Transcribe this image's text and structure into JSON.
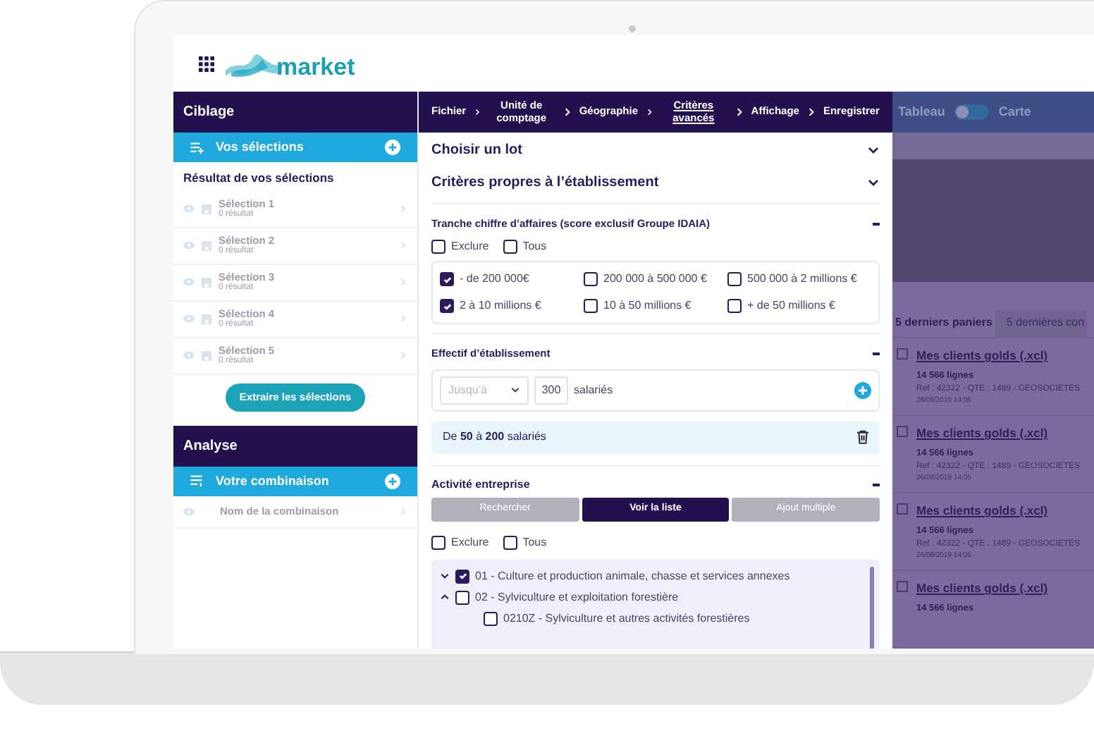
{
  "header": {
    "logo": "market"
  },
  "sidebar": {
    "ciblage": {
      "title": "Ciblage",
      "selections_header": "Vos sélections",
      "results_title": "Résultat de vos sélections",
      "selections": [
        {
          "name": "Sélection 1",
          "count": "0 résultat"
        },
        {
          "name": "Sélection 2",
          "count": "0 résultat"
        },
        {
          "name": "Sélection 3",
          "count": "0 résultat"
        },
        {
          "name": "Sélection 4",
          "count": "0 résultat"
        },
        {
          "name": "Sélection 5",
          "count": "0 résultat"
        }
      ],
      "extract_button": "Extraire les sélections"
    },
    "analyse": {
      "title": "Analyse",
      "combination_header": "Votre combinaison",
      "combination_placeholder": "Nom de la combinaison"
    }
  },
  "breadcrumb": [
    {
      "label": "Fichier",
      "selected": false
    },
    {
      "label": "Unité de comptage",
      "selected": false
    },
    {
      "label": "Géographie",
      "selected": false
    },
    {
      "label": "Critères avancés",
      "selected": true
    },
    {
      "label": "Affichage",
      "selected": false
    },
    {
      "label": "Enregistrer",
      "selected": false
    }
  ],
  "sections": [
    {
      "title": "Choisir un lot"
    },
    {
      "title": "Critères propres à l’établissement"
    }
  ],
  "revenue": {
    "title": "Tranche chiffre d’affaires (score exclusif Groupe IDAIA)",
    "options": [
      {
        "label": "Exclure",
        "checked": false
      },
      {
        "label": "Tous",
        "checked": false
      }
    ],
    "ranges": [
      {
        "label": "- de 200 000€",
        "checked": true
      },
      {
        "label": "200 000 à 500 000 €",
        "checked": false
      },
      {
        "label": "500 000 à 2 millions €",
        "checked": false
      },
      {
        "label": "2 à 10 millions €",
        "checked": true
      },
      {
        "label": "10 à 50 millions €",
        "checked": false
      },
      {
        "label": "+ de 50 millions €",
        "checked": false
      }
    ]
  },
  "workforce": {
    "title": "Effectif d’établissement",
    "operator": "Jusqu’à",
    "value": "300",
    "unit": "salariés",
    "range": "De **50** à **200** salariés"
  },
  "activity": {
    "title": "Activité entreprise",
    "buttons": [
      {
        "label": "Rechercher",
        "disabled": true
      },
      {
        "label": "Voir la liste",
        "disabled": false
      },
      {
        "label": "Ajout multiple",
        "disabled": true
      }
    ],
    "options": [
      {
        "label": "Exclure",
        "checked": false
      },
      {
        "label": "Tous",
        "checked": false
      }
    ],
    "tree": [
      {
        "label": "01 - Culture et production animale, chasse et services annexes",
        "checked": true,
        "expanded": false
      },
      {
        "label": "02 - Sylviculture et exploitation forestière",
        "checked": false,
        "expanded": true,
        "children": [
          {
            "label": "0210Z - Sylviculture et autres activités forestières",
            "checked": false
          }
        ]
      }
    ]
  },
  "right_panel": {
    "view_toggle": {
      "left": "Tableau",
      "right": "Carte",
      "on": false
    },
    "tabs": [
      {
        "label": "5 derniers paniers",
        "selected": true
      },
      {
        "label": "5 dernières con",
        "selected": false
      }
    ],
    "baskets": [
      {
        "name": "Mes clients golds (.xcl)",
        "checked": false,
        "lines": "14 566 lignes",
        "ref": "Ref : 42322 - QTE : 1489 - GEOSOCIETES",
        "date": "26/08/2019 14:05"
      },
      {
        "name": "Mes clients golds (.xcl)",
        "checked": false,
        "lines": "14 566 lignes",
        "ref": "Ref : 42322 - QTE : 1489 - GEOSOCIETES",
        "date": "26/08/2019 14:05"
      },
      {
        "name": "Mes clients golds (.xcl)",
        "checked": false,
        "lines": "14 566 lignes",
        "ref": "Ref : 42322 - QTE : 1489 - GEOSOCIETES",
        "date": "26/08/2019 14:05"
      },
      {
        "name": "Mes clients golds (.xcl)",
        "checked": false,
        "lines": "14 566 lignes"
      }
    ]
  }
}
